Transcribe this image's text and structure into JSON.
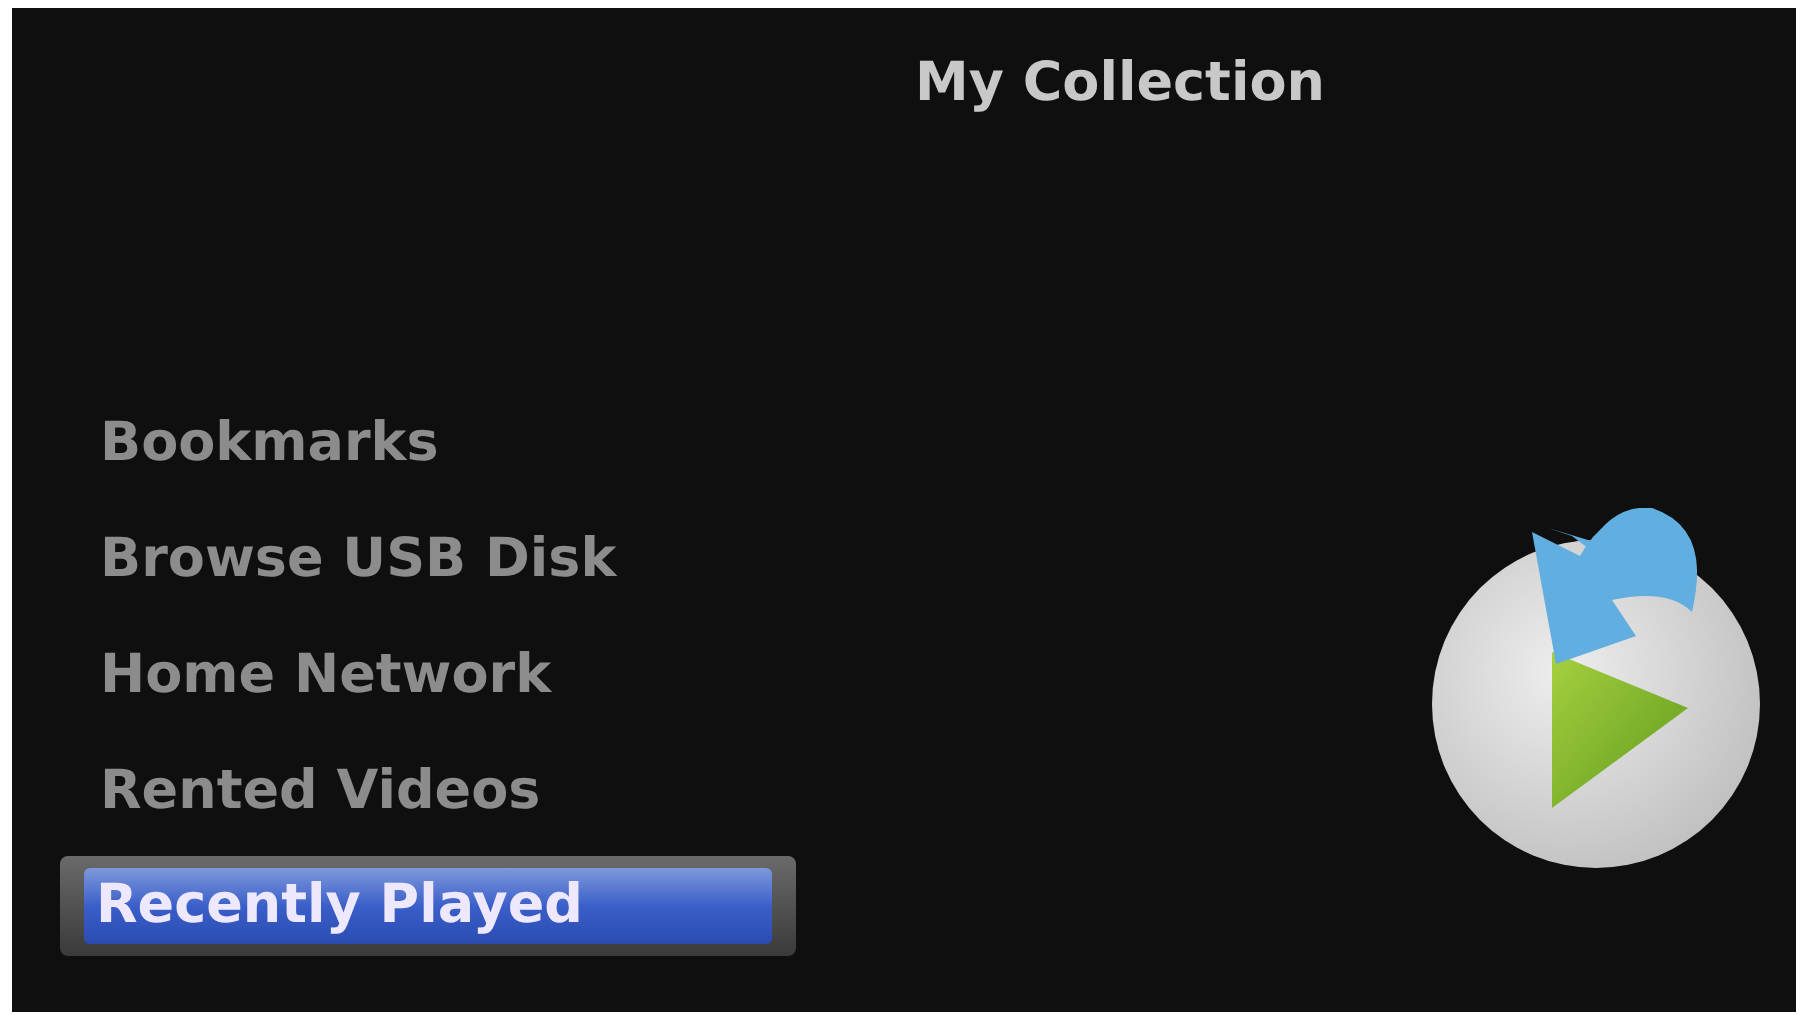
{
  "title": "My Collection",
  "menu": [
    {
      "label": "Bookmarks",
      "selected": false
    },
    {
      "label": "Browse USB Disk",
      "selected": false
    },
    {
      "label": "Home Network",
      "selected": false
    },
    {
      "label": "Rented Videos",
      "selected": false
    },
    {
      "label": "Recently Played",
      "selected": true
    }
  ]
}
